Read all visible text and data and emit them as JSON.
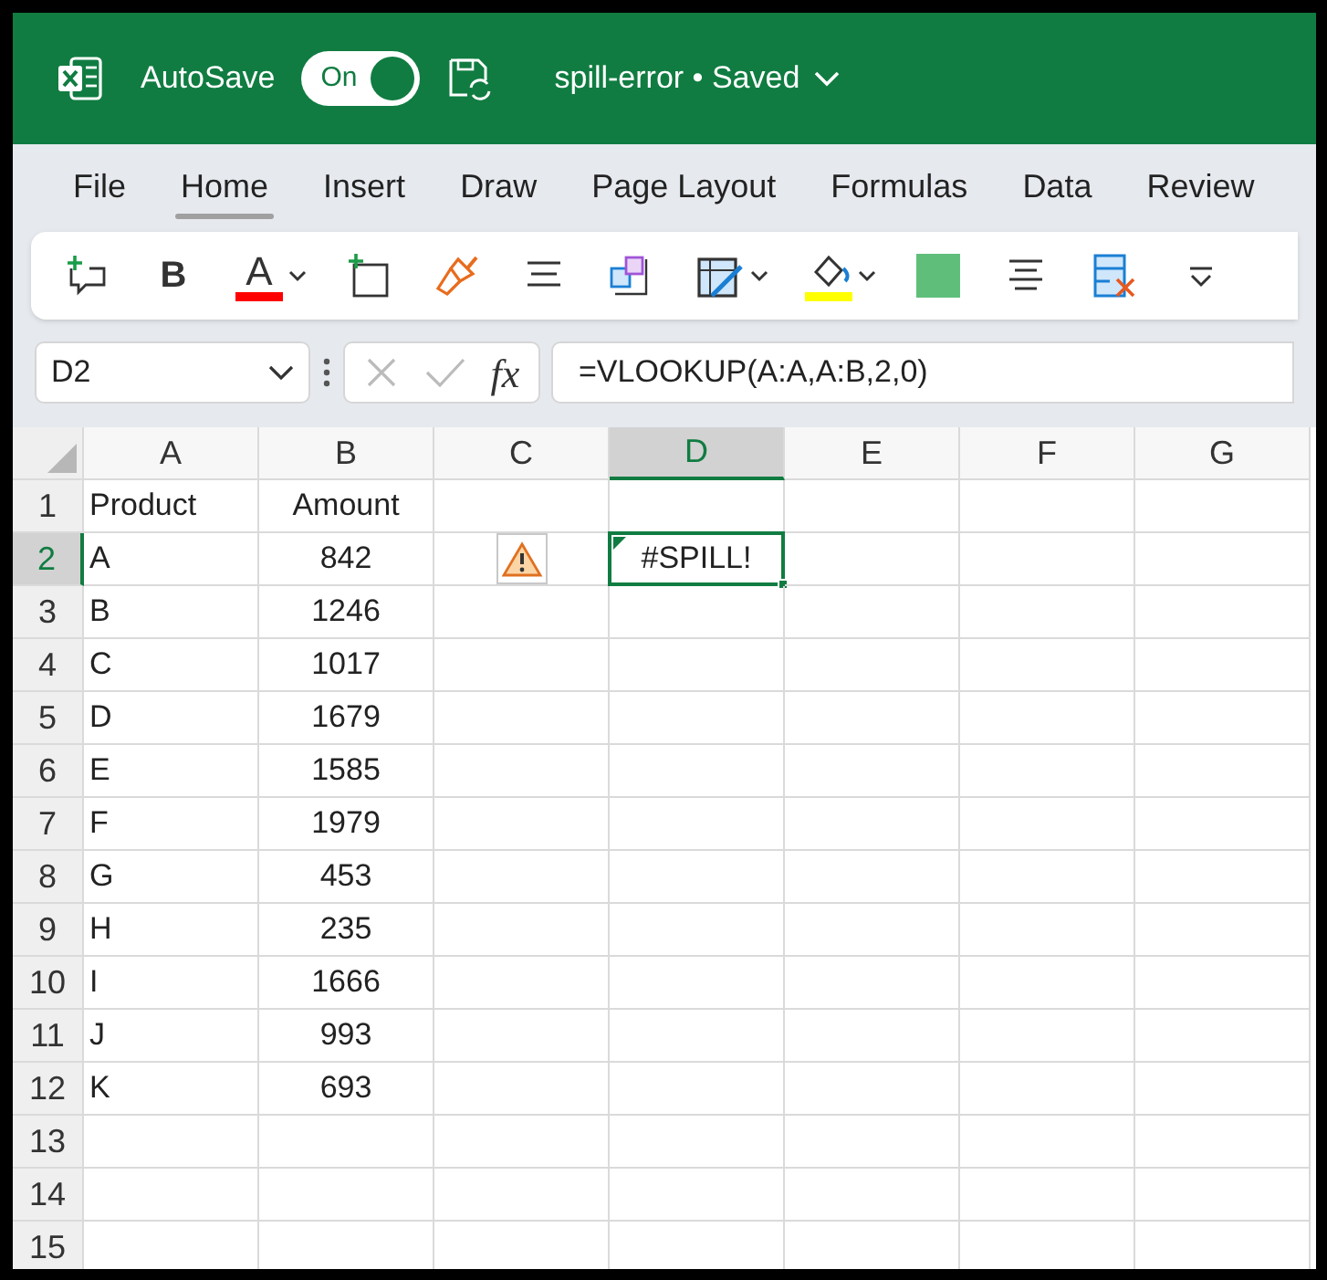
{
  "title_bar": {
    "autosave_label": "AutoSave",
    "autosave_on": true,
    "toggle_text": "On",
    "document": "spill-error • Saved"
  },
  "menu": [
    {
      "label": "File",
      "selected": false
    },
    {
      "label": "Home",
      "selected": true
    },
    {
      "label": "Insert",
      "selected": false
    },
    {
      "label": "Draw",
      "selected": false
    },
    {
      "label": "Page Layout",
      "selected": false
    },
    {
      "label": "Formulas",
      "selected": false
    },
    {
      "label": "Data",
      "selected": false
    },
    {
      "label": "Review",
      "selected": false
    }
  ],
  "ribbon": [
    {
      "kind": "comment"
    },
    {
      "kind": "bold",
      "label": "B"
    },
    {
      "kind": "font_color",
      "label": "A",
      "color": "#ff0000",
      "dropdown": true
    },
    {
      "kind": "insert"
    },
    {
      "kind": "painter"
    },
    {
      "kind": "align"
    },
    {
      "kind": "cubes"
    },
    {
      "kind": "border",
      "dropdown": true
    },
    {
      "kind": "fill",
      "color": "#ffff00",
      "dropdown": true
    },
    {
      "kind": "swatch",
      "color": "#5fbf7a"
    },
    {
      "kind": "center"
    },
    {
      "kind": "delete"
    },
    {
      "kind": "more"
    }
  ],
  "formula_bar": {
    "name_box": "D2",
    "fx": "fx",
    "formula": "=VLOOKUP(A:A,A:B,2,0)"
  },
  "columns": [
    {
      "label": "A",
      "selected": false
    },
    {
      "label": "B",
      "selected": false
    },
    {
      "label": "C",
      "selected": false
    },
    {
      "label": "D",
      "selected": true
    },
    {
      "label": "E",
      "selected": false
    },
    {
      "label": "F",
      "selected": false
    },
    {
      "label": "G",
      "selected": false
    }
  ],
  "rows": [
    {
      "label": "1",
      "product": "Product",
      "amount": "Amount",
      "selected": false
    },
    {
      "label": "2",
      "product": "A",
      "amount": "842",
      "selected": true,
      "warning": true,
      "result": "#SPILL!"
    },
    {
      "label": "3",
      "product": "B",
      "amount": "1246",
      "selected": false
    },
    {
      "label": "4",
      "product": "C",
      "amount": "1017",
      "selected": false
    },
    {
      "label": "5",
      "product": "D",
      "amount": "1679",
      "selected": false
    },
    {
      "label": "6",
      "product": "E",
      "amount": "1585",
      "selected": false
    },
    {
      "label": "7",
      "product": "F",
      "amount": "1979",
      "selected": false
    },
    {
      "label": "8",
      "product": "G",
      "amount": "453",
      "selected": false
    },
    {
      "label": "9",
      "product": "H",
      "amount": "235",
      "selected": false
    },
    {
      "label": "10",
      "product": "I",
      "amount": "1666",
      "selected": false
    },
    {
      "label": "11",
      "product": "J",
      "amount": "993",
      "selected": false
    },
    {
      "label": "12",
      "product": "K",
      "amount": "693",
      "selected": false
    },
    {
      "label": "13",
      "selected": false
    },
    {
      "label": "14",
      "selected": false
    },
    {
      "label": "15",
      "selected": false
    }
  ]
}
